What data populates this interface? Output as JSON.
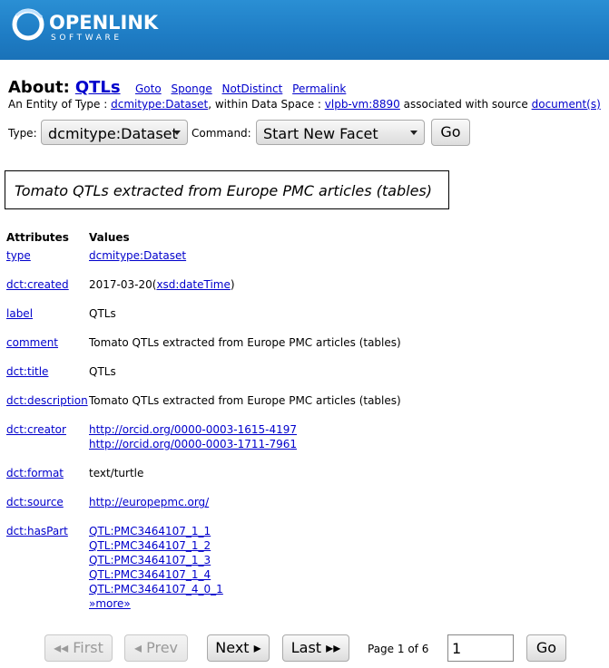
{
  "header": {
    "logo_text": "OPENLINK",
    "logo_sub": "SOFTWARE",
    "brand_color": "#1e7cc4"
  },
  "about": {
    "label": "About:",
    "title": "QTLs",
    "links": [
      "Goto",
      "Sponge",
      "NotDistinct",
      "Permalink"
    ]
  },
  "entity": {
    "prefix": "An Entity of Type :",
    "type_link": "dcmitype:Dataset",
    "middle": ", within Data Space :",
    "space_link": "vlpb-vm:8890",
    "suffix": "associated with source",
    "source_link": "document(s)"
  },
  "controls": {
    "type_label": "Type:",
    "type_value": "dcmitype:Dataset",
    "command_label": "Command:",
    "command_value": "Start New Facet",
    "go_label": "Go"
  },
  "description": "Tomato QTLs extracted from Europe PMC articles (tables)",
  "table": {
    "col_attributes": "Attributes",
    "col_values": "Values",
    "rows": [
      {
        "key": "type",
        "values": [
          {
            "text": "dcmitype:Dataset",
            "link": true
          }
        ]
      },
      {
        "key": "dct:created",
        "values": [
          {
            "text": "2017-03-20",
            "link": false,
            "paren_link": "xsd:dateTime"
          }
        ]
      },
      {
        "key": "label",
        "values": [
          {
            "text": "QTLs",
            "link": false
          }
        ]
      },
      {
        "key": "comment",
        "values": [
          {
            "text": "Tomato QTLs extracted from Europe PMC articles (tables)",
            "link": false
          }
        ]
      },
      {
        "key": "dct:title",
        "values": [
          {
            "text": "QTLs",
            "link": false
          }
        ]
      },
      {
        "key": "dct:description",
        "values": [
          {
            "text": "Tomato QTLs extracted from Europe PMC articles (tables)",
            "link": false
          }
        ]
      },
      {
        "key": "dct:creator",
        "values": [
          {
            "text": "http://orcid.org/0000-0003-1615-4197",
            "link": true
          },
          {
            "text": "http://orcid.org/0000-0003-1711-7961",
            "link": true
          }
        ]
      },
      {
        "key": "dct:format",
        "values": [
          {
            "text": "text/turtle",
            "link": false
          }
        ]
      },
      {
        "key": "dct:source",
        "values": [
          {
            "text": "http://europepmc.org/",
            "link": true
          }
        ]
      },
      {
        "key": "dct:hasPart",
        "values": [
          {
            "text": "QTL:PMC3464107_1_1",
            "link": true
          },
          {
            "text": "QTL:PMC3464107_1_2",
            "link": true
          },
          {
            "text": "QTL:PMC3464107_1_3",
            "link": true
          },
          {
            "text": "QTL:PMC3464107_1_4",
            "link": true
          },
          {
            "text": "QTL:PMC3464107_4_0_1",
            "link": true
          },
          {
            "text": "»more»",
            "link": true
          }
        ]
      }
    ]
  },
  "pager": {
    "first": "◂◂ First",
    "prev": "◂ Prev",
    "next": "Next ▸",
    "last": "Last ▸▸",
    "info": "Page 1 of 6",
    "page_value": "1",
    "go": "Go"
  }
}
